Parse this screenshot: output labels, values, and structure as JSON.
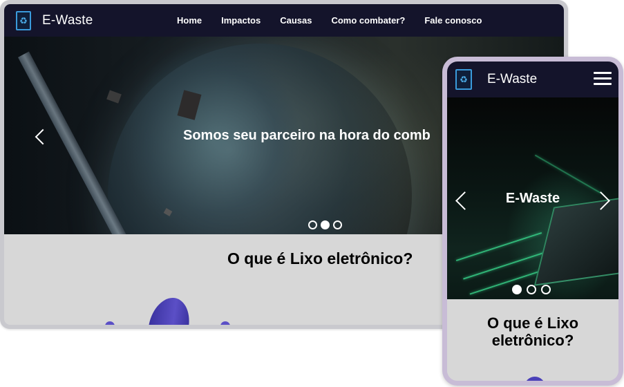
{
  "desktop": {
    "brand": "E-Waste",
    "nav": [
      "Home",
      "Impactos",
      "Causas",
      "Como combater?",
      "Fale conosco"
    ],
    "hero_caption": "Somos seu parceiro na hora do comb",
    "carousel_active_index": 1,
    "section_heading": "O que é Lixo eletrônico?"
  },
  "mobile": {
    "brand": "E-Waste",
    "hero_caption": "E-Waste",
    "carousel_active_index": 0,
    "section_heading": "O que é Lixo eletrônico?"
  },
  "icons": {
    "logo": "recycle-icon",
    "prev": "chevron-left-icon",
    "next": "chevron-right-icon",
    "menu": "hamburger-menu-icon"
  },
  "colors": {
    "navbar": "#14142b",
    "logo_accent": "#3a9bdc",
    "section_bg": "#d7d7d7",
    "illustration": "#5b4fc6"
  }
}
